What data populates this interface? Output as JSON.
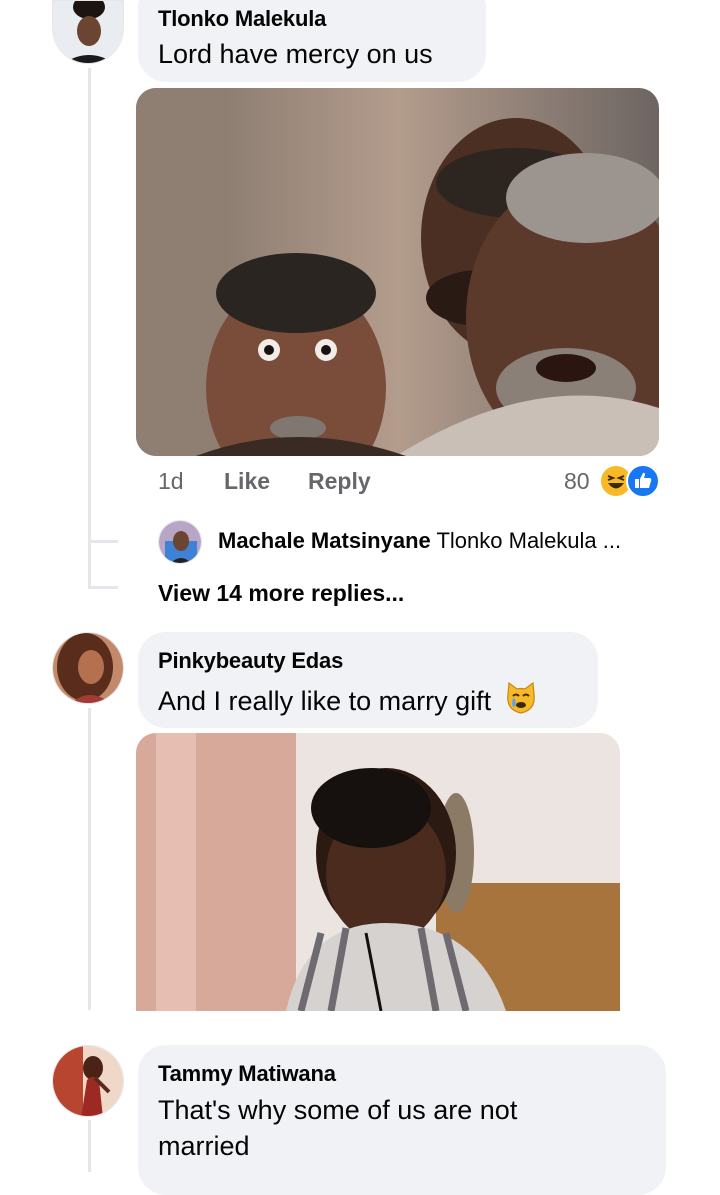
{
  "comments": [
    {
      "author": "Tlonko Malekula",
      "text": "Lord have mercy on us",
      "meta": {
        "time": "1d",
        "like_label": "Like",
        "reply_label": "Reply",
        "reaction_count": "80",
        "reaction_icons": [
          "haha-emoji-icon",
          "like-icon"
        ]
      },
      "image": "meme-photo-three-shocked-men",
      "reply_preview": {
        "author": "Machale Matsinyane",
        "text": "Tlonko Malekula ..."
      },
      "view_more": "View 14 more replies..."
    },
    {
      "author": "Pinkybeauty Edas",
      "text": "And I really like to marry gift",
      "text_emoji": "crying-cat-face-emoji",
      "image": "meme-photo-sad-boy"
    },
    {
      "author": "Tammy Matiwana",
      "text_line1": "That's why some of us are not",
      "text_line2": "married"
    }
  ],
  "colors": {
    "bubble": "#f0f2f5",
    "thread_line": "#e4e6eb",
    "meta_text": "#65676b",
    "like_blue": "#1877f2",
    "haha_yellow": "#f7b928"
  }
}
